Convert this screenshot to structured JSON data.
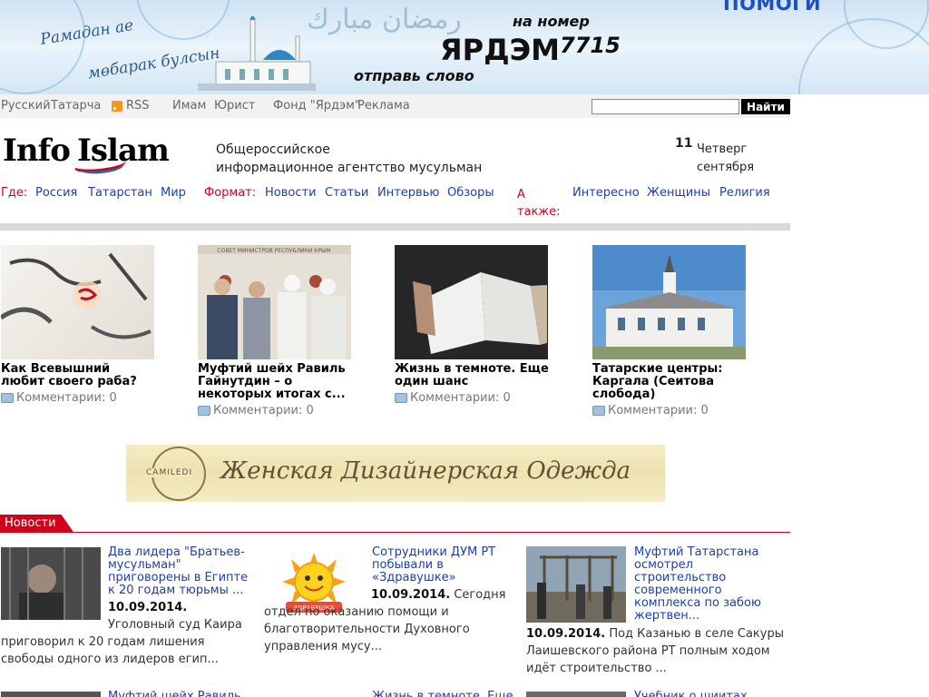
{
  "banner": {
    "script_line1": "Рамадан ае",
    "script_line2": "мөбарак булсын",
    "arabic": "رمضان مبارك",
    "send_word": "отправь слово",
    "keyword": "ЯРДЭМ",
    "to_number_label": "на номер",
    "number": "7715",
    "help": "ПОМОГИ"
  },
  "topnav": {
    "lang_ru": "Русский",
    "lang_tt": "Татарча",
    "rss": "RSS",
    "imam": "Имам",
    "lawyer": "Юрист",
    "fund": "Фонд \"Ярдэм\"",
    "ads": "Реклама",
    "search_placeholder": "",
    "search_button": "Найти"
  },
  "header": {
    "logo_info": "Info",
    "logo_islam": "Islam",
    "tagline_line1": "Общероссийское",
    "tagline_line2": "информационное агентство мусульман",
    "date_day": "11",
    "date_weekday": "Четверг",
    "date_month": "сентября"
  },
  "categories": {
    "where_label": "Где:",
    "where": [
      "Россия",
      "Татарстан",
      "Мир"
    ],
    "format_label": "Формат:",
    "format": [
      "Новости",
      "Статьи",
      "Интервью",
      "Обзоры"
    ],
    "also_label": "А также:",
    "also": [
      "Интересно",
      "Женщины",
      "Религия"
    ]
  },
  "featured": [
    {
      "title": "Как Всевышний любит своего раба?",
      "comments": "Комментарии: 0"
    },
    {
      "title": "Муфтий шейх Равиль Гайнутдин – о некоторых итогах с...",
      "comments": "Комментарии: 0"
    },
    {
      "title": "Жизнь в темноте. Еще один шанс",
      "comments": "Комментарии: 0"
    },
    {
      "title": "Татарские центры: Каргала (Сеитова слобода)",
      "comments": "Комментарии: 0"
    }
  ],
  "featured_image_texts": {
    "ministers_sign": "СОВЕТ МИНИСТРОВ РЕСПУБЛИКИ КРЫМ"
  },
  "ad": {
    "brand": "CAMILEDI",
    "text": "Женская Дизайнерская Одежда"
  },
  "news": {
    "tab": "Новости",
    "items": [
      {
        "title": "Два лидера \"Братьев-мусульман\" приговорены в Египте к 20 годам тюрьмы ...",
        "date": "10.09.2014.",
        "body": "Уголовный суд Каира приговорил к 20 годам лишения свободы одного из лидеров егип..."
      },
      {
        "title": "Сотрудники ДУМ РТ побывали в «Здравушке»",
        "date": "10.09.2014.",
        "body": "Сегодня отдел по оказанию помощи и благотворительности Духовного управления мусу...",
        "image_label": "ЗДРАВУШКА"
      },
      {
        "title": "Муфтий Татарстана осмотрел строительство современного комплекса по забою жертвен...",
        "date": "10.09.2014.",
        "body": "Под Казанью в селе Сакуры Лаишевского района РТ полным ходом идёт строительство ..."
      }
    ],
    "partial_titles": [
      "Муфтий шейх Равиль",
      "Жизнь в темноте. Еще",
      "Учебник о шиитах"
    ]
  },
  "colors": {
    "accent_red": "#d0021b",
    "link_blue": "#1a3fb0",
    "banner_blue": "#1b4fc4",
    "rss_orange": "#f7931e"
  }
}
